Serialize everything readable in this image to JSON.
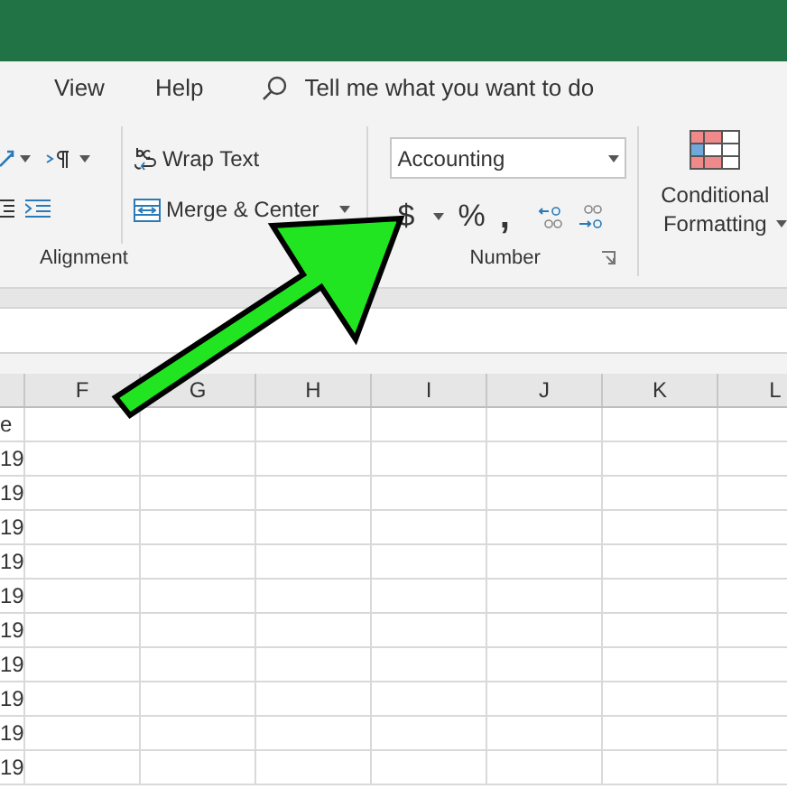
{
  "menu": [
    {
      "label": "View"
    },
    {
      "label": "Help"
    }
  ],
  "search": {
    "placeholder": "Tell me what you want to do"
  },
  "alignment": {
    "wrap_text": "Wrap Text",
    "merge_center": "Merge & Center",
    "label": "Alignment"
  },
  "number": {
    "format": "Accounting",
    "currency": "$",
    "percent": "%",
    "comma": ",",
    "label": "Number"
  },
  "conditional_formatting": "Conditional Formatting",
  "columns": [
    "F",
    "G",
    "H",
    "I",
    "J",
    "K",
    "L"
  ],
  "rows": [
    "e",
    "19",
    "19",
    "19",
    "19",
    "19",
    "19",
    "19",
    "19",
    "19",
    "19"
  ]
}
